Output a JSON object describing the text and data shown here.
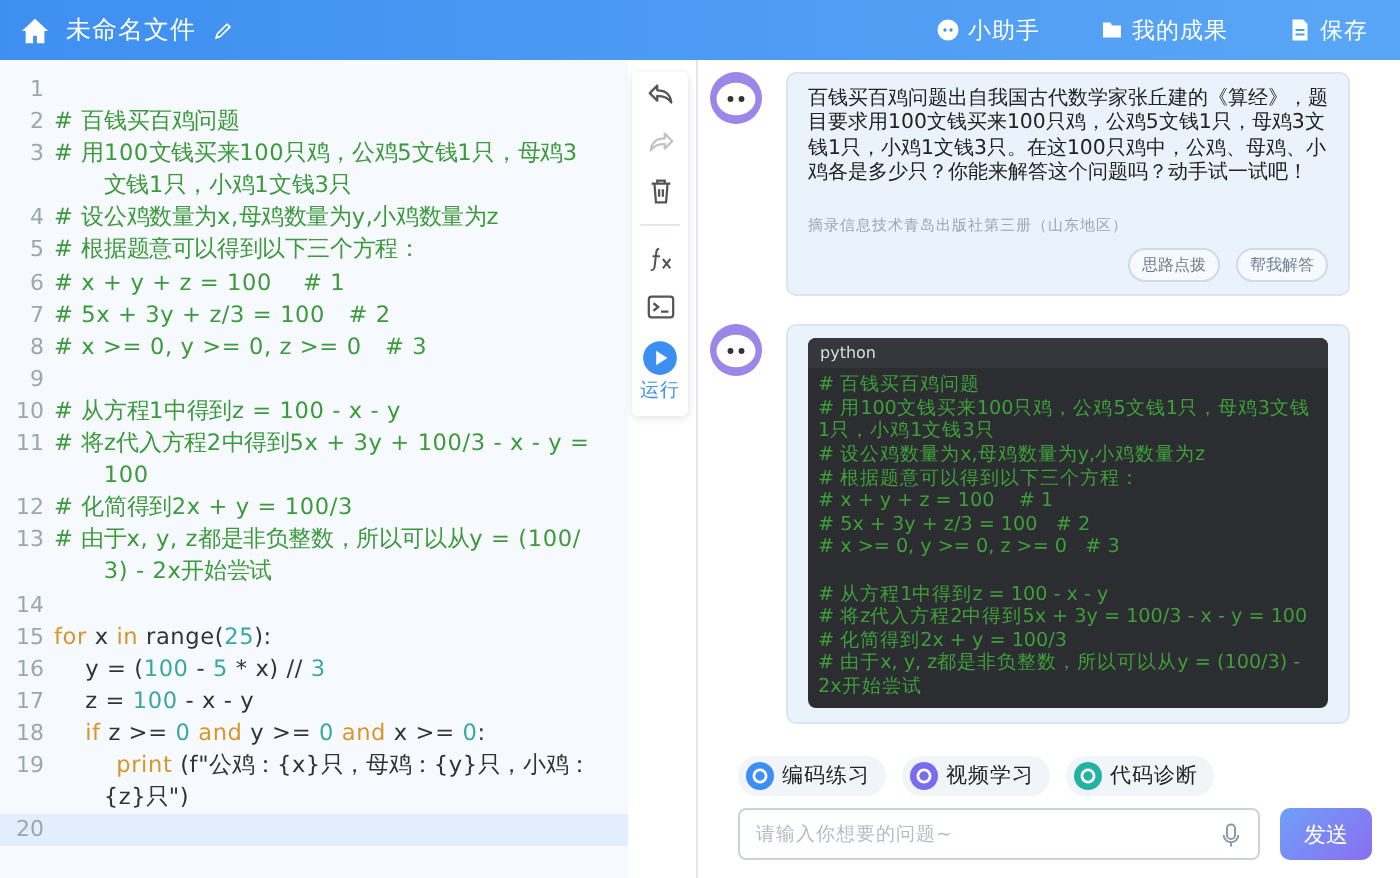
{
  "header": {
    "title": "未命名文件",
    "actions": [
      {
        "kind": "assistant",
        "label": "小助手"
      },
      {
        "kind": "results",
        "label": "我的成果"
      },
      {
        "kind": "save",
        "label": "保存"
      }
    ]
  },
  "editor": {
    "lines": [
      {
        "number": "1",
        "active": false
      },
      {
        "number": "2",
        "active": false,
        "tokens": [
          {
            "kind": "comment",
            "text": "# 百钱买百鸡问题"
          }
        ]
      },
      {
        "number": "3",
        "active": false,
        "tokens": [
          {
            "kind": "comment",
            "text": "# 用100文钱买来100只鸡，公鸡5文钱1只，母鸡3文钱1只，小鸡1文钱3只"
          }
        ]
      },
      {
        "number": "4",
        "active": false,
        "tokens": [
          {
            "kind": "comment",
            "text": "# 设公鸡数量为x,母鸡数量为y,小鸡数量为z"
          }
        ]
      },
      {
        "number": "5",
        "active": false,
        "tokens": [
          {
            "kind": "comment",
            "text": "# 根据题意可以得到以下三个方程："
          }
        ]
      },
      {
        "number": "6",
        "active": false,
        "tokens": [
          {
            "kind": "comment",
            "text": "# x + y + z = 100    # 1"
          }
        ]
      },
      {
        "number": "7",
        "active": false,
        "tokens": [
          {
            "kind": "comment",
            "text": "# 5x + 3y + z/3 = 100   # 2"
          }
        ]
      },
      {
        "number": "8",
        "active": false,
        "tokens": [
          {
            "kind": "comment",
            "text": "# x >= 0, y >= 0, z >= 0   # 3"
          }
        ]
      },
      {
        "number": "9",
        "active": false
      },
      {
        "number": "10",
        "active": false,
        "tokens": [
          {
            "kind": "comment",
            "text": "# 从方程1中得到z = 100 - x - y"
          }
        ]
      },
      {
        "number": "11",
        "active": false,
        "tokens": [
          {
            "kind": "comment",
            "text": "# 将z代入方程2中得到5x + 3y + 100/3 - x - y = 100"
          }
        ]
      },
      {
        "number": "12",
        "active": false,
        "tokens": [
          {
            "kind": "comment",
            "text": "# 化简得到2x + y = 100/3"
          }
        ]
      },
      {
        "number": "13",
        "active": false,
        "tokens": [
          {
            "kind": "comment",
            "text": "# 由于x, y, z都是非负整数，所以可以从y = (100/3) - 2x开始尝试"
          }
        ]
      },
      {
        "number": "14",
        "active": false
      },
      {
        "number": "15",
        "active": false,
        "tokens": [
          {
            "kind": "keyword",
            "text": "for"
          },
          {
            "kind": "plain",
            "text": " x "
          },
          {
            "kind": "keyword",
            "text": "in"
          },
          {
            "kind": "plain",
            "text": " range("
          },
          {
            "kind": "number",
            "text": "25"
          },
          {
            "kind": "plain",
            "text": "):"
          }
        ]
      },
      {
        "number": "16",
        "active": false,
        "tokens": [
          {
            "kind": "plain",
            "text": "    y = ("
          },
          {
            "kind": "number",
            "text": "100"
          },
          {
            "kind": "plain",
            "text": " - "
          },
          {
            "kind": "number",
            "text": "5"
          },
          {
            "kind": "plain",
            "text": " * x) // "
          },
          {
            "kind": "number",
            "text": "3"
          }
        ]
      },
      {
        "number": "17",
        "active": false,
        "tokens": [
          {
            "kind": "plain",
            "text": "    z = "
          },
          {
            "kind": "number",
            "text": "100"
          },
          {
            "kind": "plain",
            "text": " - x - y"
          }
        ]
      },
      {
        "number": "18",
        "active": false,
        "tokens": [
          {
            "kind": "keyword",
            "text": "    if"
          },
          {
            "kind": "plain",
            "text": " z >= "
          },
          {
            "kind": "number",
            "text": "0"
          },
          {
            "kind": "keyword",
            "text": " and"
          },
          {
            "kind": "plain",
            "text": " y >= "
          },
          {
            "kind": "number",
            "text": "0"
          },
          {
            "kind": "keyword",
            "text": " and"
          },
          {
            "kind": "plain",
            "text": " x >= "
          },
          {
            "kind": "number",
            "text": "0"
          },
          {
            "kind": "plain",
            "text": ":"
          }
        ]
      },
      {
        "number": "19",
        "active": false,
        "tokens": [
          {
            "kind": "keyword",
            "text": "        print"
          },
          {
            "kind": "plain",
            "text": " (f\"公鸡：{x}只，母鸡：{y}只，小鸡：{z}只\")"
          }
        ]
      },
      {
        "number": "20",
        "active": true
      }
    ]
  },
  "toolbar": [
    {
      "kind": "undo",
      "disabled": false
    },
    {
      "kind": "redo",
      "disabled": true
    },
    {
      "kind": "delete",
      "disabled": false
    },
    {
      "kind": "function",
      "disabled": false
    },
    {
      "kind": "terminal",
      "disabled": false
    },
    {
      "kind": "run",
      "disabled": false,
      "label": "运行"
    }
  ],
  "chat": {
    "messages": [
      {
        "kind": "text",
        "text": "百钱买百鸡问题出自我国古代数学家张丘建的《算经》，题目要求用100文钱买来100只鸡，公鸡5文钱1只，母鸡3文钱1只，小鸡1文钱3只。在这100只鸡中，公鸡、母鸡、小鸡各是多少只？你能来解答这个问题吗？动手试一试吧！",
        "source": "摘录信息技术青岛出版社第三册（山东地区）",
        "buttons": [
          "思路点拨",
          "帮我解答"
        ]
      },
      {
        "kind": "code",
        "language": "python",
        "code": [
          {
            "text": "# 百钱买百鸡问题",
            "gap_before": false
          },
          {
            "text": "# 用100文钱买来100只鸡，公鸡5文钱1只，母鸡3文钱1只，小鸡1文钱3只",
            "gap_before": false
          },
          {
            "text": "# 设公鸡数量为x,母鸡数量为y,小鸡数量为z",
            "gap_before": false
          },
          {
            "text": "# 根据题意可以得到以下三个方程：",
            "gap_before": false
          },
          {
            "text": "# x + y + z = 100    # 1",
            "gap_before": false
          },
          {
            "text": "# 5x + 3y + z/3 = 100   # 2",
            "gap_before": false
          },
          {
            "text": "# x >= 0, y >= 0, z >= 0   # 3",
            "gap_before": false
          },
          {
            "text": "# 从方程1中得到z = 100 - x - y",
            "gap_before": true
          },
          {
            "text": "# 将z代入方程2中得到5x + 3y = 100/3 - x - y = 100",
            "gap_before": false
          },
          {
            "text": "# 化简得到2x + y = 100/3",
            "gap_before": false
          },
          {
            "text": "# 由于x, y, z都是非负整数，所以可以从y = (100/3) - 2x开始尝试",
            "gap_before": false
          }
        ]
      }
    ],
    "chips": [
      {
        "label": "编码练习",
        "color": "#3d8ef2"
      },
      {
        "label": "视频学习",
        "color": "#7a6cf0"
      },
      {
        "label": "代码诊断",
        "color": "#22b3a3"
      }
    ],
    "input": {
      "placeholder": "请输入你想要的问题~"
    },
    "send": "发送"
  }
}
